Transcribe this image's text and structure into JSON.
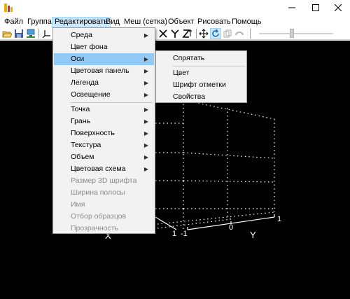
{
  "window": {
    "icon": "app-logo-icon",
    "controls": [
      "minimize-icon",
      "maximize-icon",
      "close-icon"
    ]
  },
  "menubar": {
    "items": [
      "Файл",
      "Группа",
      "Редактировать",
      "Вид",
      "Меш (сетка)",
      "Объект",
      "Рисовать",
      "Помощь"
    ],
    "active_index": 2
  },
  "toolbar": {
    "icons": [
      "open-folder-icon",
      "save-icon",
      "network-icon",
      "axes-icon",
      "axes-x-icon",
      "axes-y-icon",
      "axes-z-icon",
      "move-icon",
      "rotate-icon",
      "copy-icon",
      "undo-icon"
    ],
    "slider_level": 0.46
  },
  "edit_menu": {
    "items": [
      {
        "label": "Среда",
        "submenu": true,
        "enabled": true
      },
      {
        "label": "Цвет фона",
        "submenu": false,
        "enabled": true
      },
      {
        "label": "Оси",
        "submenu": true,
        "enabled": true,
        "selected": true
      },
      {
        "label": "Цветовая панель",
        "submenu": true,
        "enabled": true
      },
      {
        "label": "Легенда",
        "submenu": true,
        "enabled": true
      },
      {
        "label": "Освещение",
        "submenu": true,
        "enabled": true
      },
      {
        "label": "Точка",
        "submenu": true,
        "enabled": true
      },
      {
        "label": "Грань",
        "submenu": true,
        "enabled": true
      },
      {
        "label": "Поверхность",
        "submenu": true,
        "enabled": true
      },
      {
        "label": "Текстура",
        "submenu": true,
        "enabled": true
      },
      {
        "label": "Объем",
        "submenu": true,
        "enabled": true
      },
      {
        "label": "Цветовая схема",
        "submenu": true,
        "enabled": true
      },
      {
        "label": "Размер 3D шрифта",
        "submenu": false,
        "enabled": false
      },
      {
        "label": "Ширина полосы",
        "submenu": false,
        "enabled": false
      },
      {
        "label": "Имя",
        "submenu": false,
        "enabled": false
      },
      {
        "label": "Отбор образцов",
        "submenu": false,
        "enabled": false
      },
      {
        "label": "Прозрачность",
        "submenu": false,
        "enabled": false
      }
    ]
  },
  "axes_submenu": {
    "items": [
      "Спрятать",
      "Цвет",
      "Шрифт отметки",
      "Свойства"
    ]
  },
  "plot": {
    "background": "#000000",
    "x_axis_label": "X",
    "y_axis_label": "Y",
    "x_tick_labels": [
      "1"
    ],
    "y_tick_labels": [
      "-1",
      "0",
      "1"
    ]
  }
}
